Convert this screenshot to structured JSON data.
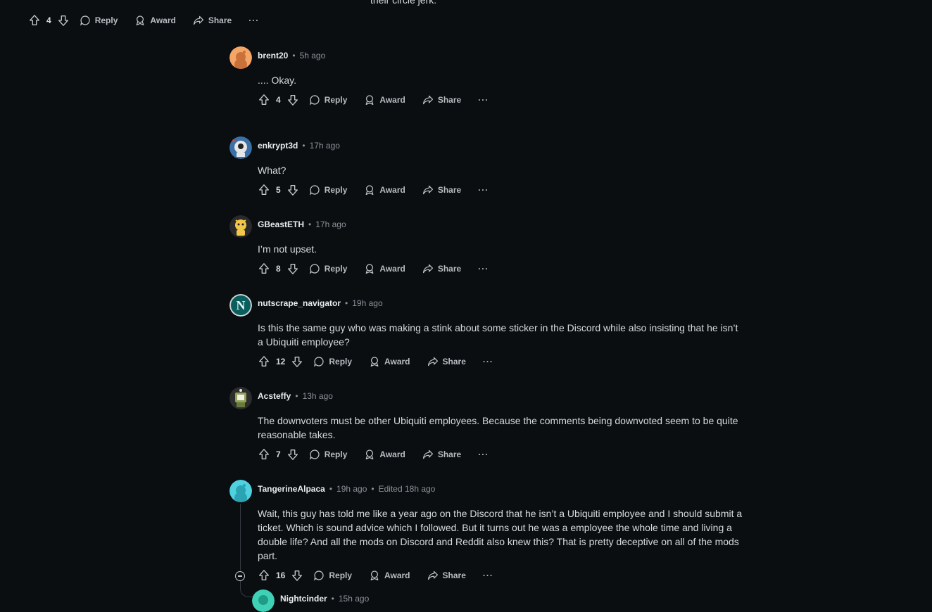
{
  "top_fragment": {
    "text": "their circle jerk.",
    "votes": "4",
    "reply_label": "Reply",
    "award_label": "Award",
    "share_label": "Share",
    "more_label": "···"
  },
  "comments": [
    {
      "author": "brent20",
      "time": "5h ago",
      "edited": "",
      "body": ".... Okay.",
      "votes": "4",
      "avatar_color": "#f5a565"
    },
    {
      "author": "enkrypt3d",
      "time": "17h ago",
      "edited": "",
      "body": "What?",
      "votes": "5",
      "avatar_color": "#3a6fa8"
    },
    {
      "author": "GBeastETH",
      "time": "17h ago",
      "edited": "",
      "body": "I’m not upset.",
      "votes": "8",
      "avatar_color": "#2a2a2a"
    },
    {
      "author": "nutscrape_navigator",
      "time": "19h ago",
      "edited": "",
      "body": "Is this the same guy who was making a stink about some sticker in the Discord while also insisting that he isn’t a Ubiquiti employee?",
      "votes": "12",
      "avatar_color": "#0b5e5e"
    },
    {
      "author": "Acsteffy",
      "time": "13h ago",
      "edited": "",
      "body": "The downvoters must be other Ubiquiti employees. Because the comments being downvoted seem to be quite reasonable takes.",
      "votes": "7",
      "avatar_color": "#2d2d2d"
    },
    {
      "author": "TangerineAlpaca",
      "time": "19h ago",
      "edited": "Edited 18h ago",
      "body": "Wait, this guy has told me like a year ago on the Discord that he isn’t a Ubiquiti employee and I should submit a ticket. Which is sound advice which I followed. But it turns out he was a employee the whole time and living a double life? And all the mods on Discord and Reddit also knew this? That is pretty deceptive on all of the mods part.",
      "votes": "16",
      "avatar_color": "#4fd1e0"
    },
    {
      "author": "Nightcinder",
      "time": "15h ago",
      "edited": "",
      "body": "",
      "votes": "",
      "avatar_color": "#3fd1b5"
    }
  ],
  "labels": {
    "reply": "Reply",
    "award": "Award",
    "share": "Share",
    "more": "···",
    "separator": "•"
  }
}
